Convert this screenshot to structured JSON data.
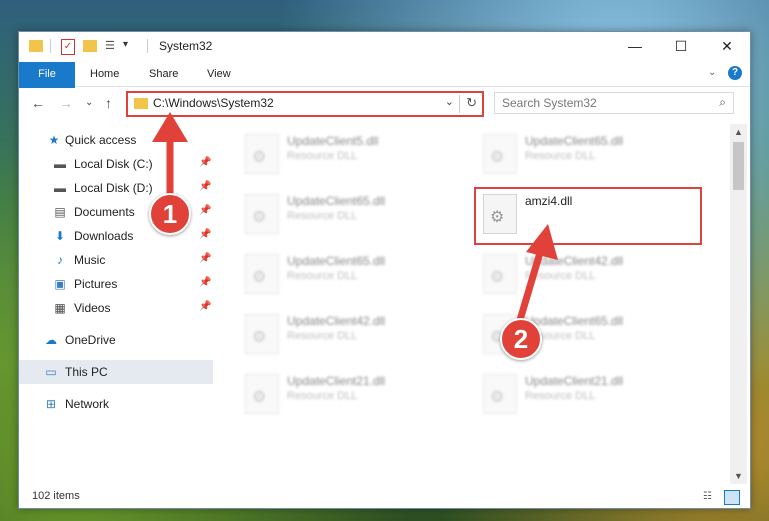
{
  "window": {
    "title": "System32",
    "minimize": "—",
    "maximize": "☐",
    "close": "✕"
  },
  "ribbon": {
    "tabs": [
      "File",
      "Home",
      "Share",
      "View"
    ],
    "help": "?"
  },
  "navbar": {
    "address": "C:\\Windows\\System32",
    "search_placeholder": "Search System32"
  },
  "sidebar": {
    "items": [
      {
        "label": "Quick access",
        "icon": "star-icon"
      },
      {
        "label": "Local Disk (C:)",
        "icon": "drive-icon"
      },
      {
        "label": "Local Disk (D:)",
        "icon": "drive-icon"
      },
      {
        "label": "Documents",
        "icon": "documents-icon"
      },
      {
        "label": "Downloads",
        "icon": "downloads-icon"
      },
      {
        "label": "Music",
        "icon": "music-icon"
      },
      {
        "label": "Pictures",
        "icon": "pictures-icon"
      },
      {
        "label": "Videos",
        "icon": "videos-icon"
      },
      {
        "label": "OneDrive",
        "icon": "cloud-icon"
      },
      {
        "label": "This PC",
        "icon": "computer-icon"
      },
      {
        "label": "Network",
        "icon": "network-icon"
      }
    ]
  },
  "files": [
    {
      "name": "UpdateClient5.dll",
      "type": "Resource DLL"
    },
    {
      "name": "UpdateClient65.dll",
      "type": "Resource DLL"
    },
    {
      "name": "UpdateClient65.dll",
      "type": "Resource DLL"
    },
    {
      "name": "amzi4.dll",
      "type": ""
    },
    {
      "name": "UpdateClient65.dll",
      "type": "Resource DLL"
    },
    {
      "name": "UpdateClient42.dll",
      "type": "Resource DLL"
    },
    {
      "name": "UpdateClient42.dll",
      "type": "Resource DLL"
    },
    {
      "name": "UpdateClient65.dll",
      "type": "Resource DLL"
    },
    {
      "name": "UpdateClient21.dll",
      "type": "Resource DLL"
    },
    {
      "name": "UpdateClient21.dll",
      "type": "Resource DLL"
    }
  ],
  "status": {
    "items_count": "102 items"
  },
  "annotations": {
    "step1": "1",
    "step2": "2"
  },
  "colors": {
    "accent": "#1979ca",
    "annotation": "#e0423a"
  }
}
